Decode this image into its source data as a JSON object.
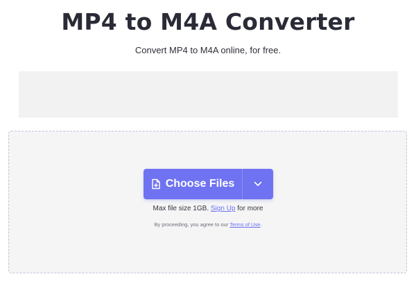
{
  "header": {
    "title": "MP4 to M4A Converter",
    "subtitle": "Convert MP4 to M4A online, for free."
  },
  "upload": {
    "choose_files_label": "Choose Files",
    "max_size_prefix": "Max file size 1GB.",
    "sign_up_label": "Sign Up",
    "max_size_suffix": "for more",
    "terms_prefix": "By proceeding, you agree to our",
    "terms_link_label": "Terms of Use",
    "terms_suffix": "."
  },
  "icons": {
    "choose_files_icon": "file-plus-icon",
    "dropdown_icon": "chevron-down-icon"
  },
  "colors": {
    "accent": "#6f73f1",
    "link": "#6a6ff0",
    "title": "#2a2b36",
    "dropzone_border": "#c4c0de",
    "dropzone_bg": "#f5f5f6",
    "ad_bg": "#f2f2f3"
  }
}
